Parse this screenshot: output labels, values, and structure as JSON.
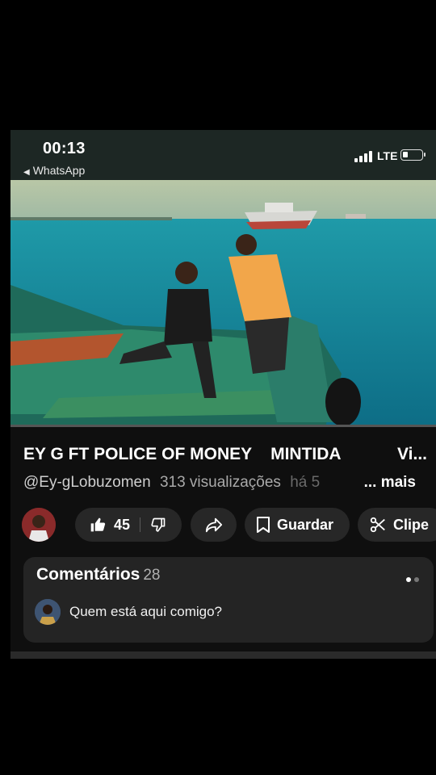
{
  "status_bar": {
    "time": "00:13",
    "back_label": "WhatsApp",
    "network": "LTE",
    "battery_level": 0.25
  },
  "video": {
    "progress": 0.0,
    "accent_color": "#ff0033"
  },
  "details": {
    "title": "EY G FT POLICE OF MONEY    MINTIDA",
    "title_overflow": "Vi...",
    "channel": "@Ey-gLobuzomen",
    "views": "313 visualizações",
    "age": "há 5",
    "more_label": "... mais"
  },
  "actions": {
    "likes": "45",
    "save_label": "Guardar",
    "clip_label": "Clipe"
  },
  "comments": {
    "heading": "Comentários",
    "count": "28",
    "prompt": "Quem está aqui comigo?"
  },
  "icons": [
    "back-arrow-icon",
    "signal-icon",
    "battery-icon",
    "thumbs-up-icon",
    "thumbs-down-icon",
    "share-icon",
    "bookmark-icon",
    "scissors-icon"
  ]
}
